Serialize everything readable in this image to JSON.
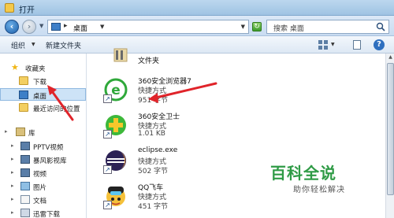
{
  "window": {
    "title": "打开"
  },
  "address": {
    "crumb": "桌面",
    "search_placeholder": "搜索 桌面"
  },
  "toolbar": {
    "organize": "组织",
    "new_folder": "新建文件夹"
  },
  "nav": {
    "favorites": "收藏夹",
    "download": "下载",
    "desktop": "桌面",
    "recent": "最近访问的位置",
    "library": "库",
    "pptv": "PPTV视频",
    "storm": "暴风影视库",
    "video": "视频",
    "pictures": "图片",
    "docs": "文档",
    "thunder": "迅雷下载"
  },
  "files": [
    {
      "name": "文件夹",
      "type": "",
      "size": "",
      "icon": "folder-icon"
    },
    {
      "name": "360安全浏览器7",
      "type": "快捷方式",
      "size": "951 字节",
      "icon": "360-browser-icon"
    },
    {
      "name": "360安全卫士",
      "type": "快捷方式",
      "size": "1.01 KB",
      "icon": "360-safe-icon"
    },
    {
      "name": "eclipse.exe",
      "type": "快捷方式",
      "size": "502 字节",
      "icon": "eclipse-icon"
    },
    {
      "name": "QQ飞车",
      "type": "快捷方式",
      "size": "451 字节",
      "icon": "qq-speed-icon"
    }
  ],
  "watermark": {
    "title": "百科全说",
    "subtitle": "助你轻松解决"
  },
  "colors": {
    "accent": "#2f9b46",
    "selection": "#cde3f7",
    "arrow": "#e0242a"
  }
}
